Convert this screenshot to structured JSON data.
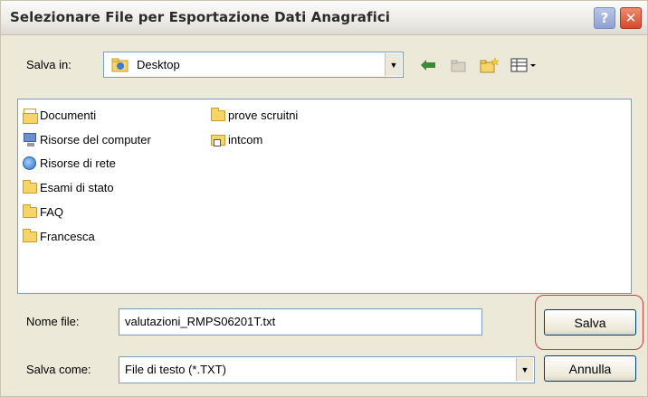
{
  "window": {
    "title": "Selezionare File per Esportazione Dati Anagrafici",
    "help_label": "?",
    "close_label": "✕"
  },
  "toolbar": {
    "save_in_label": "Salva in:",
    "save_in_value": "Desktop",
    "icons": [
      "back-arrow-icon",
      "up-folder-icon",
      "new-folder-icon",
      "view-menu-icon"
    ]
  },
  "files": [
    {
      "name": "Documenti",
      "icon": "documents-icon"
    },
    {
      "name": "Risorse del computer",
      "icon": "computer-icon"
    },
    {
      "name": "Risorse di rete",
      "icon": "network-icon"
    },
    {
      "name": "Esami di stato",
      "icon": "folder-icon"
    },
    {
      "name": "FAQ",
      "icon": "folder-icon"
    },
    {
      "name": "Francesca",
      "icon": "folder-icon"
    },
    {
      "name": "prove scruitni",
      "icon": "folder-icon"
    },
    {
      "name": "intcom",
      "icon": "shortcut-folder-icon"
    }
  ],
  "form": {
    "filename_label": "Nome file:",
    "filename_value": "valutazioni_RMPS06201T.txt",
    "savetype_label": "Salva come:",
    "savetype_value": "File di testo (*.TXT)",
    "save_button": "Salva",
    "cancel_button": "Annulla"
  },
  "colors": {
    "dialog_bg": "#ece9d8",
    "highlight": "#d63a3a",
    "close_button": "#d4482c"
  }
}
